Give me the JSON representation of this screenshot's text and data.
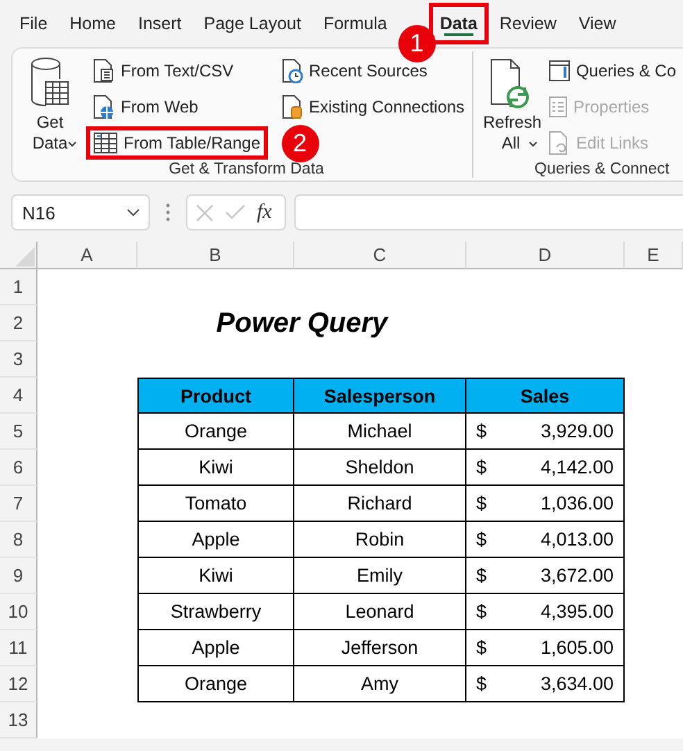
{
  "tabs": [
    {
      "label": "File",
      "selected": false,
      "highlighted": false
    },
    {
      "label": "Home",
      "selected": false,
      "highlighted": false
    },
    {
      "label": "Insert",
      "selected": false,
      "highlighted": false
    },
    {
      "label": "Page Layout",
      "selected": false,
      "highlighted": false
    },
    {
      "label": "Formula",
      "selected": false,
      "highlighted": false
    },
    {
      "label": "Data",
      "selected": true,
      "highlighted": true
    },
    {
      "label": "Review",
      "selected": false,
      "highlighted": false
    },
    {
      "label": "View",
      "selected": false,
      "highlighted": false
    }
  ],
  "callouts": [
    {
      "label": "1"
    },
    {
      "label": "2"
    }
  ],
  "ribbon": {
    "groups": [
      {
        "title": "Get & Transform Data",
        "large_button": {
          "label": "Get Data",
          "has_menu": true
        },
        "columns": [
          [
            {
              "label": "From Text/CSV",
              "disabled": false,
              "highlighted": false
            },
            {
              "label": "From Web",
              "disabled": false,
              "highlighted": false
            },
            {
              "label": "From Table/Range",
              "disabled": false,
              "highlighted": true
            }
          ],
          [
            {
              "label": "Recent Sources",
              "disabled": false,
              "highlighted": false
            },
            {
              "label": "Existing Connections",
              "disabled": false,
              "highlighted": false
            }
          ]
        ]
      },
      {
        "title": "Queries & Connect",
        "large_button": {
          "label": "Refresh All",
          "has_menu": true
        },
        "columns": [
          [
            {
              "label": "Queries & Co",
              "disabled": false,
              "highlighted": false
            },
            {
              "label": "Properties",
              "disabled": true,
              "highlighted": false
            },
            {
              "label": "Edit Links",
              "disabled": true,
              "highlighted": false
            }
          ]
        ]
      }
    ]
  },
  "formula_bar": {
    "name_box": "N16",
    "fx": "fx"
  },
  "sheet": {
    "columns": [
      "A",
      "B",
      "C",
      "D",
      "E"
    ],
    "rows": [
      "1",
      "2",
      "3",
      "4",
      "5",
      "6",
      "7",
      "8",
      "9",
      "10",
      "11",
      "12",
      "13"
    ],
    "title": "Power Query",
    "table": {
      "columns": [
        "Product",
        "Salesperson",
        "Sales"
      ],
      "rows": [
        {
          "product": "Orange",
          "salesperson": "Michael",
          "currency": "$",
          "sales": "3,929.00"
        },
        {
          "product": "Kiwi",
          "salesperson": "Sheldon",
          "currency": "$",
          "sales": "4,142.00"
        },
        {
          "product": "Tomato",
          "salesperson": "Richard",
          "currency": "$",
          "sales": "1,036.00"
        },
        {
          "product": "Apple",
          "salesperson": "Robin",
          "currency": "$",
          "sales": "4,013.00"
        },
        {
          "product": "Kiwi",
          "salesperson": "Emily",
          "currency": "$",
          "sales": "3,672.00"
        },
        {
          "product": "Strawberry",
          "salesperson": "Leonard",
          "currency": "$",
          "sales": "4,395.00"
        },
        {
          "product": "Apple",
          "salesperson": "Jefferson",
          "currency": "$",
          "sales": "1,605.00"
        },
        {
          "product": "Orange",
          "salesperson": "Amy",
          "currency": "$",
          "sales": "3,634.00"
        }
      ]
    }
  }
}
